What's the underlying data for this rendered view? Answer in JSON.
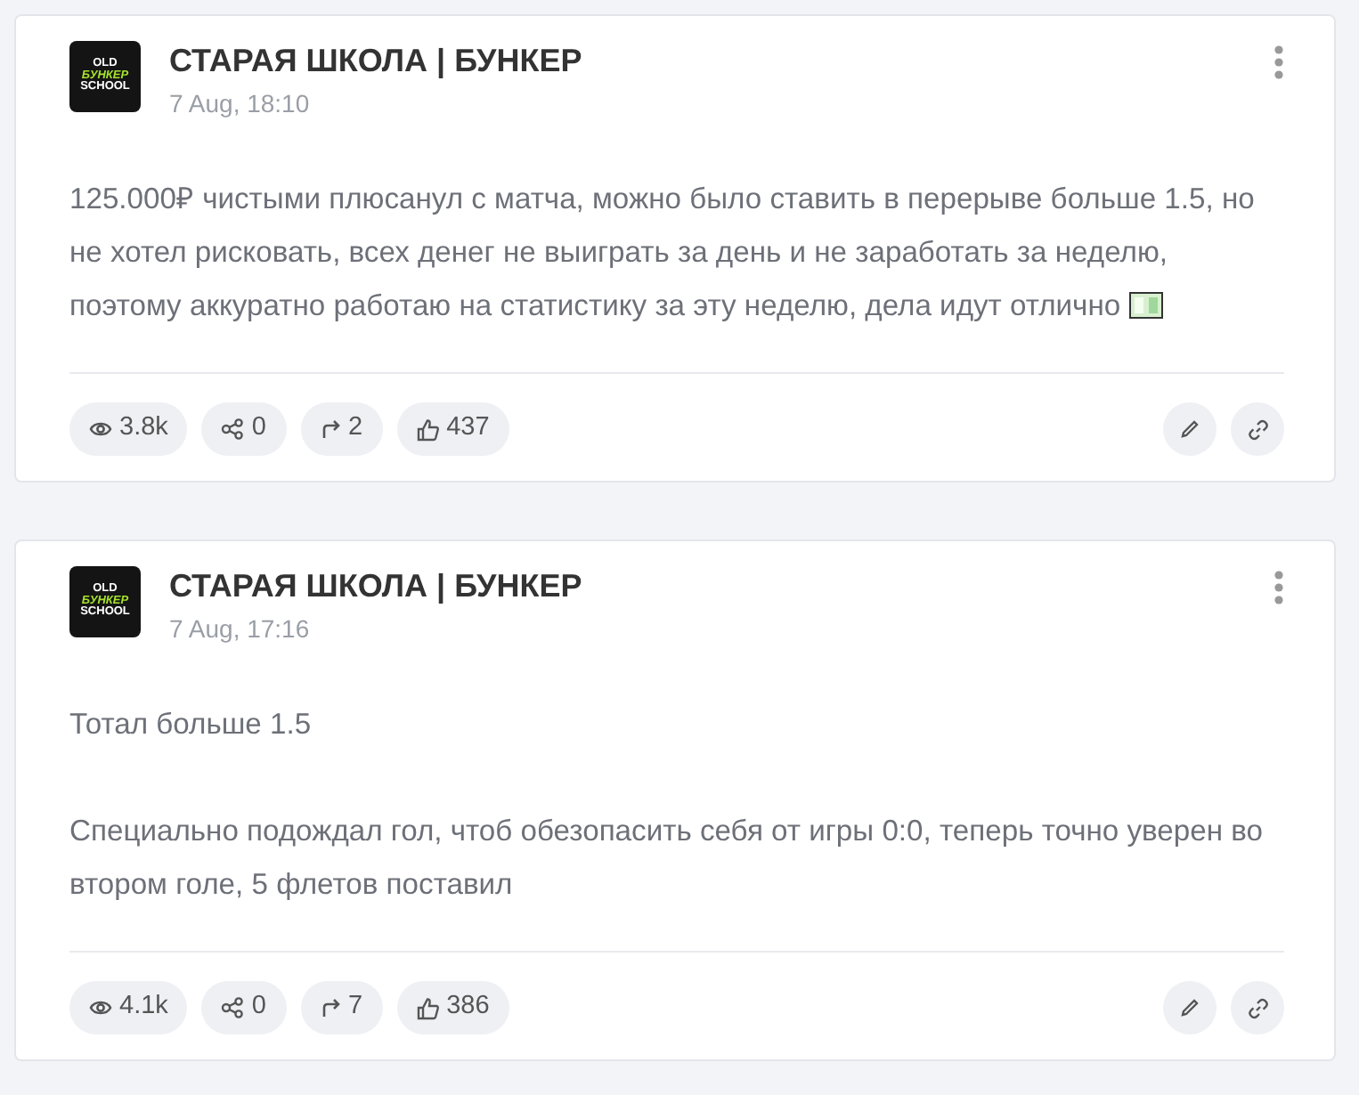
{
  "posts": [
    {
      "channel": "СТАРАЯ ШКОЛА | БУНКЕР",
      "logo": [
        "OLD",
        "БУНКЕР",
        "SCHOOL"
      ],
      "date": "7 Aug, 18:10",
      "paragraphs": [
        "125.000₽ чистыми плюсанул с матча, можно было ставить в перерыве больше 1.5, но не хотел рисковать, всех денег не выиграть за день и не заработать за неделю, поэтому аккуратно работаю на статистику за эту неделю, дела идут отлично"
      ],
      "ends_with_money": true,
      "stats": [
        {
          "kind": "views",
          "text": "3.8k"
        },
        {
          "kind": "shares",
          "text": "0"
        },
        {
          "kind": "forwards",
          "text": "2"
        },
        {
          "kind": "likes",
          "text": "437"
        }
      ]
    },
    {
      "channel": "СТАРАЯ ШКОЛА | БУНКЕР",
      "logo": [
        "OLD",
        "БУНКЕР",
        "SCHOOL"
      ],
      "date": "7 Aug, 17:16",
      "paragraphs": [
        "Тотал больше 1.5",
        "Специально подождал гол, чтоб обезопасить себя от игры 0:0, теперь точно уверен во втором голе, 5 флетов поставил"
      ],
      "ends_with_money": false,
      "stats": [
        {
          "kind": "views",
          "text": "4.1k"
        },
        {
          "kind": "shares",
          "text": "0"
        },
        {
          "kind": "forwards",
          "text": "7"
        },
        {
          "kind": "likes",
          "text": "386"
        }
      ]
    }
  ]
}
